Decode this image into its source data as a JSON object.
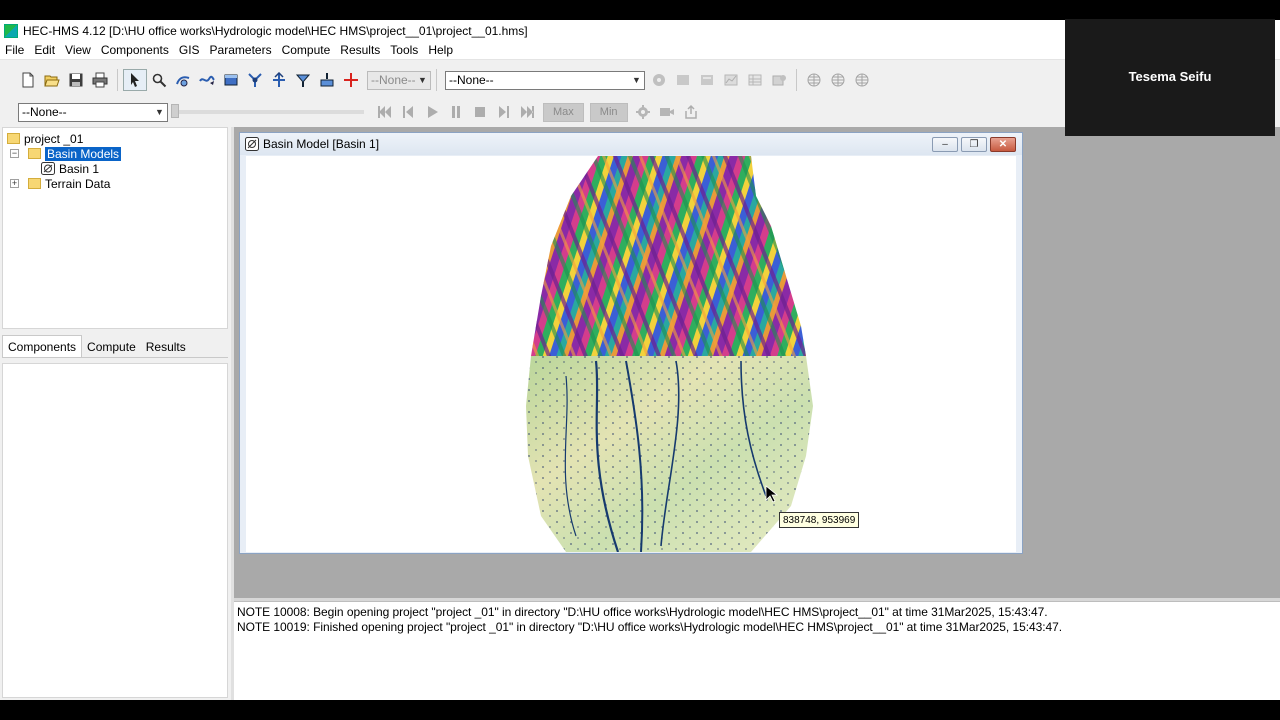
{
  "window": {
    "title": "HEC-HMS 4.12 [D:\\HU office works\\Hydrologic model\\HEC HMS\\project__01\\project__01.hms]"
  },
  "menu": [
    "File",
    "Edit",
    "View",
    "Components",
    "GIS",
    "Parameters",
    "Compute",
    "Results",
    "Tools",
    "Help"
  ],
  "toolbar": {
    "disabled_combo": "--None--",
    "run_combo": "--None--",
    "left_combo": "--None--",
    "max_label": "Max",
    "min_label": "Min"
  },
  "tree": {
    "root": "project _01",
    "basin_models": "Basin Models",
    "basin_1": "Basin 1",
    "terrain_data": "Terrain Data"
  },
  "tabs": [
    "Components",
    "Compute",
    "Results"
  ],
  "basin_window": {
    "title": "Basin Model [Basin 1]",
    "coordinate_tooltip": "838748, 953969"
  },
  "messages": [
    "NOTE 10008:  Begin opening project \"project _01\" in directory \"D:\\HU office works\\Hydrologic model\\HEC HMS\\project__01\" at time 31Mar2025, 15:43:47.",
    "NOTE 10019:  Finished opening project \"project _01\" in directory \"D:\\HU office works\\Hydrologic model\\HEC HMS\\project__01\" at time 31Mar2025, 15:43:47."
  ],
  "overlay": {
    "participant_name": "Tesema Seifu"
  },
  "colors": {
    "selection": "#0a64c8",
    "desktop": "#a9a9a9",
    "tooltip": "#ffffe1"
  }
}
